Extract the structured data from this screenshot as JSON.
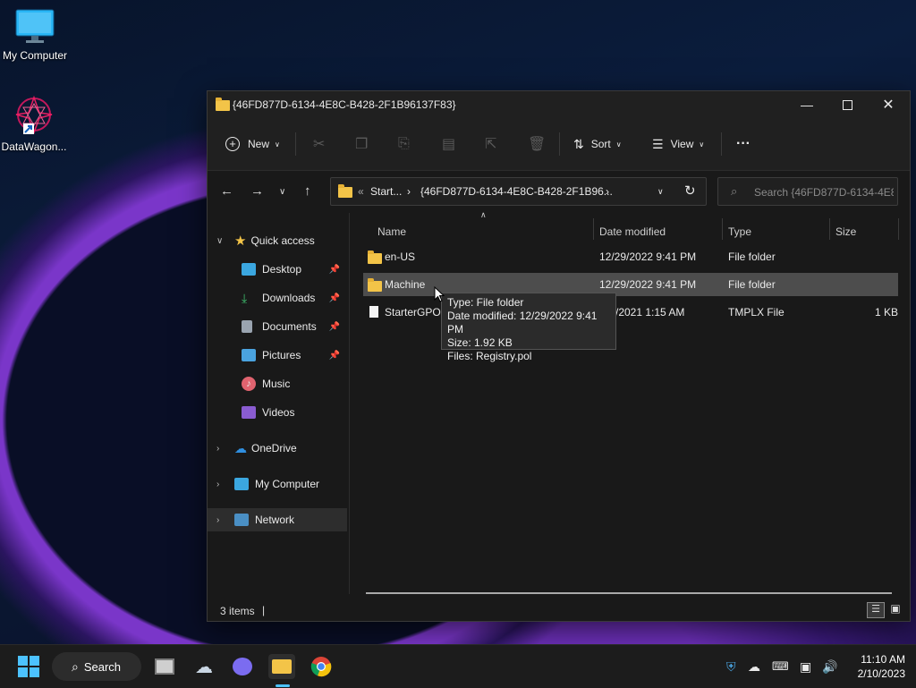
{
  "desktop": {
    "icons": [
      {
        "label": "My Computer"
      },
      {
        "label": "DataWagon..."
      }
    ]
  },
  "window": {
    "title": "{46FD877D-6134-4E8C-B428-2F1B96137F83}",
    "toolbar": {
      "new_label": "New",
      "sort_label": "Sort",
      "view_label": "View",
      "more_label": "···"
    },
    "address": {
      "crumb1": "Start...",
      "crumb2": "{46FD877D-6134-4E8C-B428-2F1B96...",
      "sep": "›",
      "overflow": "«"
    },
    "search": {
      "placeholder": "Search {46FD877D-6134-4E8..."
    },
    "sidebar": {
      "quick_access": "Quick access",
      "items": [
        {
          "label": "Desktop"
        },
        {
          "label": "Downloads"
        },
        {
          "label": "Documents"
        },
        {
          "label": "Pictures"
        },
        {
          "label": "Music"
        },
        {
          "label": "Videos"
        }
      ],
      "onedrive": "OneDrive",
      "my_computer": "My Computer",
      "network": "Network"
    },
    "columns": {
      "name": "Name",
      "date": "Date modified",
      "type": "Type",
      "size": "Size"
    },
    "files": [
      {
        "name": "en-US",
        "date": "12/29/2022 9:41 PM",
        "type": "File folder",
        "size": ""
      },
      {
        "name": "Machine",
        "date": "12/29/2022 9:41 PM",
        "type": "File folder",
        "size": ""
      },
      {
        "name": "StarterGPO.",
        "date": "/2021 1:15 AM",
        "type": "TMPLX File",
        "size": "1 KB"
      }
    ],
    "tooltip": {
      "line1": "Type: File folder",
      "line2": "Date modified: 12/29/2022 9:41 PM",
      "line3": "Size: 1.92 KB",
      "line4": "Files: Registry.pol"
    },
    "status": {
      "count": "3 items",
      "divider": "|"
    }
  },
  "taskbar": {
    "search_label": "Search",
    "time": "11:10 AM",
    "date": "2/10/2023"
  }
}
